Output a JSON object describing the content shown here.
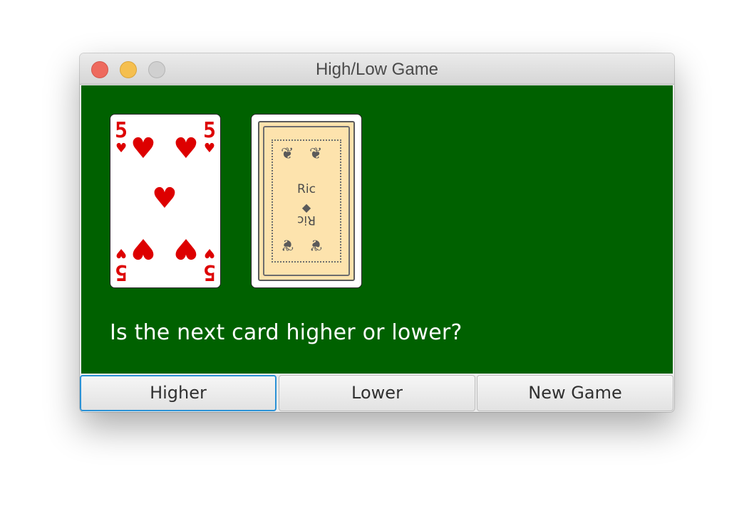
{
  "window": {
    "title": "High/Low Game"
  },
  "table": {
    "background": "#006100",
    "prompt": "Is the next card higher or lower?",
    "cards": [
      {
        "rank": "5",
        "suit": "♥",
        "suit_name": "hearts",
        "color": "#dd0000",
        "face_up": true
      },
      {
        "back_text_top": "Ric",
        "back_text_bottom": "Ric",
        "face_up": false,
        "back_color": "#fde3ad"
      }
    ]
  },
  "buttons": {
    "higher": "Higher",
    "lower": "Lower",
    "new_game": "New Game"
  },
  "icons": {
    "close": "close-button-icon",
    "minimize": "minimize-button-icon",
    "zoom": "zoom-button-icon"
  }
}
